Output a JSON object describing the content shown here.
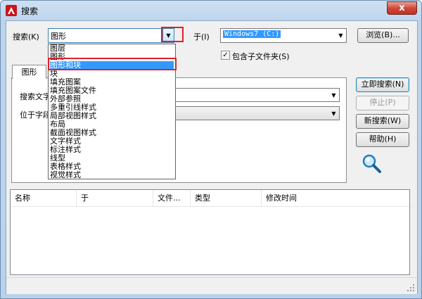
{
  "window": {
    "title": "搜索",
    "close_glyph": "x"
  },
  "search_row": {
    "label": "搜索(K)",
    "combo_value": "图形",
    "in_label": "于(I)",
    "in_value": "Windows7 (C:)",
    "browse_label": "浏览(B)...",
    "include_subfolders_label": "包含子文件夹(S)",
    "include_subfolders_checked": true
  },
  "dropdown": {
    "items": [
      "图层",
      "图形",
      "图形和块",
      "块",
      "填充图案",
      "填充图案文件",
      "外部参照",
      "多重引线样式",
      "局部视图样式",
      "布局",
      "截面视图样式",
      "文字样式",
      "标注样式",
      "线型",
      "表格样式",
      "视觉样式"
    ],
    "selected_index": 2
  },
  "tab": {
    "label": "图形",
    "search_text_label": "搜索文字",
    "located_in_label": "位于字段"
  },
  "buttons": {
    "search_now": "立即搜索(N)",
    "stop": "停止(P)",
    "new_search": "新搜索(W)",
    "help": "帮助(H)"
  },
  "results": {
    "columns": [
      "名称",
      "于",
      "文件...",
      "类型",
      "修改时间"
    ]
  },
  "colors": {
    "selection": "#3399ff",
    "highlight_box": "#e0202a",
    "close_button": "#c2301f"
  }
}
